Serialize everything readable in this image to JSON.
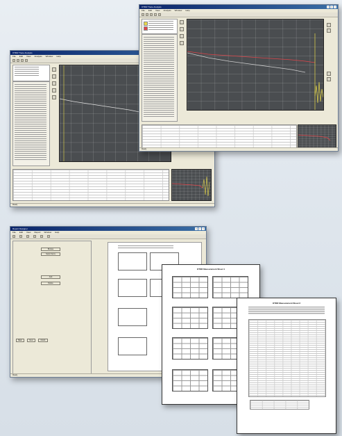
{
  "window_front": {
    "title": "OTDR Trace Analysis",
    "menu": [
      "File",
      "Edit",
      "View",
      "Analysis",
      "Window",
      "Help"
    ],
    "status": "Ready"
  },
  "window_back": {
    "title": "OTDR Trace Analysis",
    "menu": [
      "File",
      "Edit",
      "View",
      "Analysis",
      "Window",
      "Help"
    ],
    "status": "Ready"
  },
  "window_report": {
    "title": "Report Designer",
    "menu": [
      "File",
      "Edit",
      "View",
      "Report",
      "Window",
      "Help"
    ],
    "buttons": [
      "Browse",
      "Select Items",
      "Add",
      "Delete",
      "Back",
      "Next",
      "Finish"
    ],
    "status": "Ready"
  },
  "printout_1": {
    "title": "OTDR Measurement Sheet 1"
  },
  "printout_2": {
    "title": "OTDR Measurement Sheet 2"
  },
  "colors": {
    "plot_bg": "#4a4d50",
    "trace_red": "#e0454a",
    "trace_yellow": "#e7d84a",
    "title_bar": "#0a246a"
  }
}
